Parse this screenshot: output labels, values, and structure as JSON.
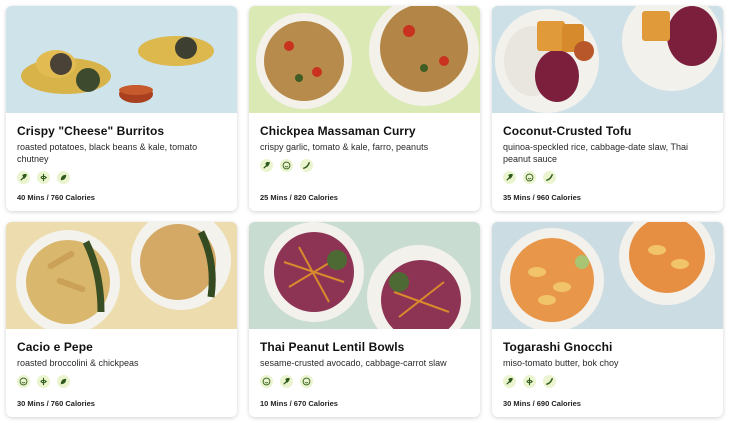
{
  "recipes": [
    {
      "title": "Crispy \"Cheese\" Burritos",
      "description": "roasted potatoes, black beans & kale, tomato chutney",
      "meta": "40 Mins / 760 Calories",
      "icons": [
        "leaf-sprout-icon",
        "no-nuts-icon",
        "plant-based-icon"
      ],
      "image_bg": "#cfe3ea"
    },
    {
      "title": "Chickpea Massaman Curry",
      "description": "crispy garlic, tomato & kale, farro, peanuts",
      "meta": "25 Mins / 820 Calories",
      "icons": [
        "leaf-sprout-icon",
        "smiley-icon",
        "spicy-icon"
      ],
      "image_bg": "#dbe9b4"
    },
    {
      "title": "Coconut-Crusted Tofu",
      "description": "quinoa-speckled rice, cabbage-date slaw, Thai peanut sauce",
      "meta": "35 Mins / 960 Calories",
      "icons": [
        "leaf-sprout-icon",
        "smiley-icon",
        "spicy-icon"
      ],
      "image_bg": "#cde0e8"
    },
    {
      "title": "Cacio e Pepe",
      "description": "roasted broccolini & chickpeas",
      "meta": "30 Mins / 760 Calories",
      "icons": [
        "smiley-icon",
        "no-nuts-icon",
        "plant-based-icon"
      ],
      "image_bg": "#ecdcae"
    },
    {
      "title": "Thai Peanut Lentil Bowls",
      "description": "sesame-crusted avocado, cabbage-carrot slaw",
      "meta": "10 Mins / 670 Calories",
      "icons": [
        "smiley-icon",
        "leaf-sprout-icon",
        "smiley-icon"
      ],
      "image_bg": "#c9dcd2"
    },
    {
      "title": "Togarashi Gnocchi",
      "description": "miso-tomato butter, bok choy",
      "meta": "30 Mins / 690 Calories",
      "icons": [
        "leaf-sprout-icon",
        "no-nuts-icon",
        "spicy-icon"
      ],
      "image_bg": "#cbdde3"
    }
  ],
  "colors": {
    "icon_bg": "#eaf4cf",
    "icon_fg": "#2f5a1c"
  }
}
